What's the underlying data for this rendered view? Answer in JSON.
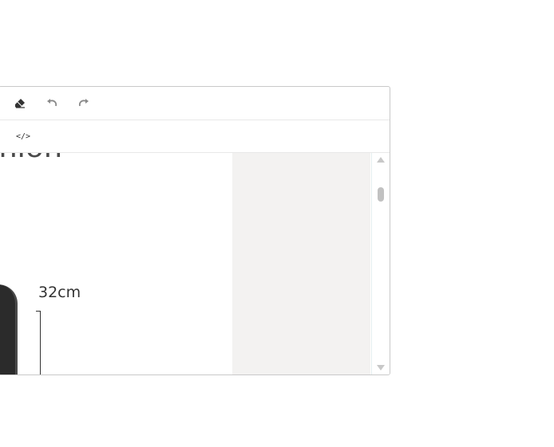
{
  "toolbar": {
    "row1": {
      "eraser": "eraser-icon",
      "undo": "undo-icon",
      "redo": "redo-icon"
    },
    "row2": {
      "source": "code-icon",
      "source_glyph": "</>"
    }
  },
  "content": {
    "heading_fragment": "nion",
    "measurement_label": "32cm"
  },
  "colors": {
    "panel_gray": "#f3f2f1",
    "border": "#c9c9c9",
    "icon": "#444444"
  }
}
